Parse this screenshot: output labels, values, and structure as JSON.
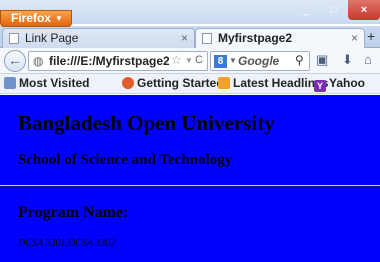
{
  "window": {
    "app_button": "Firefox",
    "min_glyph": "_",
    "max_glyph": "□",
    "close_glyph": "×"
  },
  "tabs": [
    {
      "label": "Link Page",
      "close": "×"
    },
    {
      "label": "Myfirstpage2",
      "close": "×"
    }
  ],
  "new_tab": "+",
  "navigation": {
    "url": "file:///E:/Myfirstpage2.ht",
    "search_engine": "Google"
  },
  "bookmarks": [
    {
      "label": "Most Visited"
    },
    {
      "label": "Getting Started"
    },
    {
      "label": "Latest Headlines"
    },
    {
      "label": "Yahoo",
      "icon_letter": "Y"
    }
  ],
  "page": {
    "background": "#0000ff",
    "heading": "Bangladesh Open University",
    "subheading": "School of Science and Technology",
    "program_label": "Program Name:",
    "courses": "DCSA 3301,DCSA 3302"
  }
}
